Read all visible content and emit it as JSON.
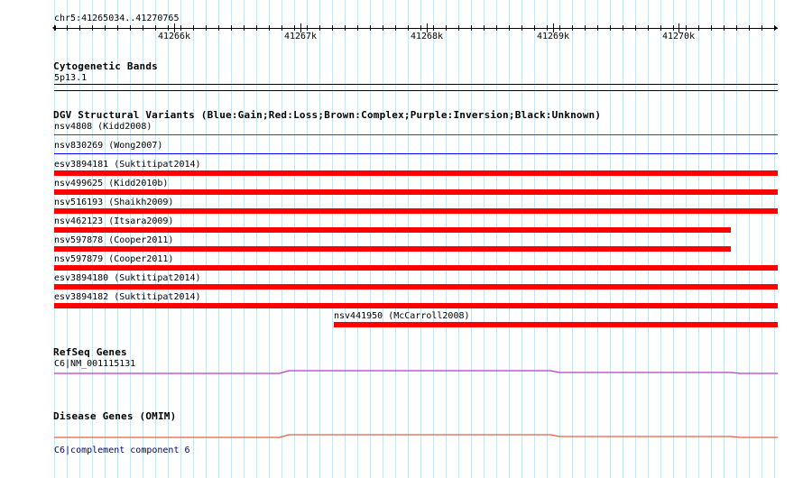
{
  "browser": {
    "location": "chr5:41265034..41270765",
    "ruler_ticks": [
      "41266k",
      "41267k",
      "41268k",
      "41269k",
      "41270k"
    ]
  },
  "tracks": {
    "cytoband": {
      "title": "Cytogenetic Bands",
      "band_label": "5p13.1"
    },
    "dgv": {
      "title": "DGV Structural Variants (Blue:Gain;Red:Loss;Brown:Complex;Purple:Inversion;Black:Unknown)",
      "features": [
        {
          "label": "nsv4808 (Kidd2008)",
          "type": "loss-line",
          "color": "#ff0000"
        },
        {
          "label": "nsv830269 (Wong2007)",
          "type": "gain-line",
          "color": "#0000ff"
        },
        {
          "label": "esv3894181 (Suktitipat2014)",
          "type": "loss-bar",
          "color": "#ff0000"
        },
        {
          "label": "nsv499625 (Kidd2010b)",
          "type": "loss-bar",
          "color": "#ff0000"
        },
        {
          "label": "nsv516193 (Shaikh2009)",
          "type": "loss-bar",
          "color": "#ff0000"
        },
        {
          "label": "nsv462123 (Itsara2009)",
          "type": "loss-bar",
          "color": "#ff0000"
        },
        {
          "label": "nsv597878 (Cooper2011)",
          "type": "loss-bar",
          "color": "#ff0000"
        },
        {
          "label": "nsv597879 (Cooper2011)",
          "type": "loss-bar",
          "color": "#ff0000"
        },
        {
          "label": "esv3894180 (Suktitipat2014)",
          "type": "loss-bar",
          "color": "#ff0000"
        },
        {
          "label": "esv3894182 (Suktitipat2014)",
          "type": "loss-bar",
          "color": "#ff0000"
        },
        {
          "label": "nsv441950 (McCarroll2008)",
          "type": "loss-bar",
          "color": "#ff0000"
        }
      ]
    },
    "refseq": {
      "title": "RefSeq Genes",
      "gene_label": "C6|NM_001115131",
      "color": "#b040c0"
    },
    "omim": {
      "title": "Disease Genes (OMIM)",
      "gene_label": "C6|complement component 6",
      "color": "#e06040"
    }
  }
}
